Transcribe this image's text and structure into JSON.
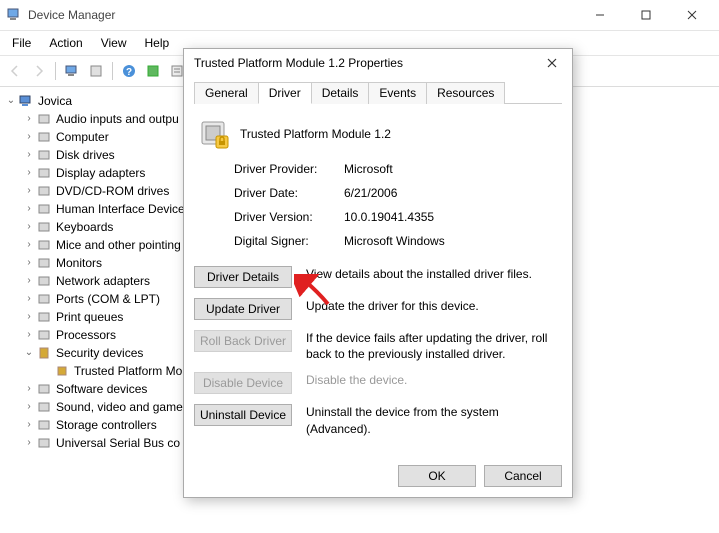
{
  "window": {
    "title": "Device Manager",
    "menus": [
      "File",
      "Action",
      "View",
      "Help"
    ]
  },
  "tree": {
    "root": "Jovica",
    "items": [
      "Audio inputs and outpu",
      "Computer",
      "Disk drives",
      "Display adapters",
      "DVD/CD-ROM drives",
      "Human Interface Device",
      "Keyboards",
      "Mice and other pointing",
      "Monitors",
      "Network adapters",
      "Ports (COM & LPT)",
      "Print queues",
      "Processors"
    ],
    "security_label": "Security devices",
    "security_child": "Trusted Platform Mo",
    "items2": [
      "Software devices",
      "Sound, video and game",
      "Storage controllers",
      "Universal Serial Bus co"
    ]
  },
  "dialog": {
    "title": "Trusted Platform Module 1.2 Properties",
    "tabs": [
      "General",
      "Driver",
      "Details",
      "Events",
      "Resources"
    ],
    "active_tab": 1,
    "device_name": "Trusted Platform Module 1.2",
    "info": {
      "provider_label": "Driver Provider:",
      "provider": "Microsoft",
      "date_label": "Driver Date:",
      "date": "6/21/2006",
      "version_label": "Driver Version:",
      "version": "10.0.19041.4355",
      "signer_label": "Digital Signer:",
      "signer": "Microsoft Windows"
    },
    "buttons": {
      "details": "Driver Details",
      "details_desc": "View details about the installed driver files.",
      "update": "Update Driver",
      "update_desc": "Update the driver for this device.",
      "rollback": "Roll Back Driver",
      "rollback_desc": "If the device fails after updating the driver, roll back to the previously installed driver.",
      "disable": "Disable Device",
      "disable_desc": "Disable the device.",
      "uninstall": "Uninstall Device",
      "uninstall_desc": "Uninstall the device from the system (Advanced).",
      "ok": "OK",
      "cancel": "Cancel"
    }
  }
}
